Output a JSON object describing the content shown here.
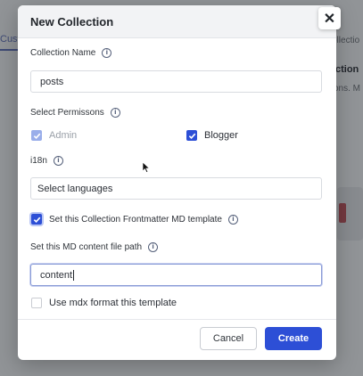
{
  "background": {
    "left_tab_fragment": "Cust",
    "right_fragment_1": "ollectio",
    "right_fragment_2": "ction",
    "right_fragment_3": "ons. M"
  },
  "modal": {
    "title": "New Collection",
    "close_icon": "close-icon",
    "collection_name": {
      "label": "Collection Name",
      "value": "posts"
    },
    "permissions": {
      "label": "Select Permissons",
      "options": [
        {
          "label": "Admin",
          "checked": true,
          "disabled": true
        },
        {
          "label": "Blogger",
          "checked": true,
          "disabled": false
        }
      ]
    },
    "i18n": {
      "label": "i18n",
      "placeholder": "Select languages"
    },
    "frontmatter_template": {
      "label": "Set this Collection Frontmatter MD template",
      "checked": true
    },
    "content_path": {
      "label": "Set this MD content file path",
      "value": "content"
    },
    "mdx_format": {
      "label": "Use mdx format this template",
      "checked": false
    },
    "buttons": {
      "cancel": "Cancel",
      "create": "Create"
    }
  },
  "colors": {
    "primary": "#2d4fd6",
    "disabled_check": "#9aaeea",
    "overlay": "#191c21"
  }
}
